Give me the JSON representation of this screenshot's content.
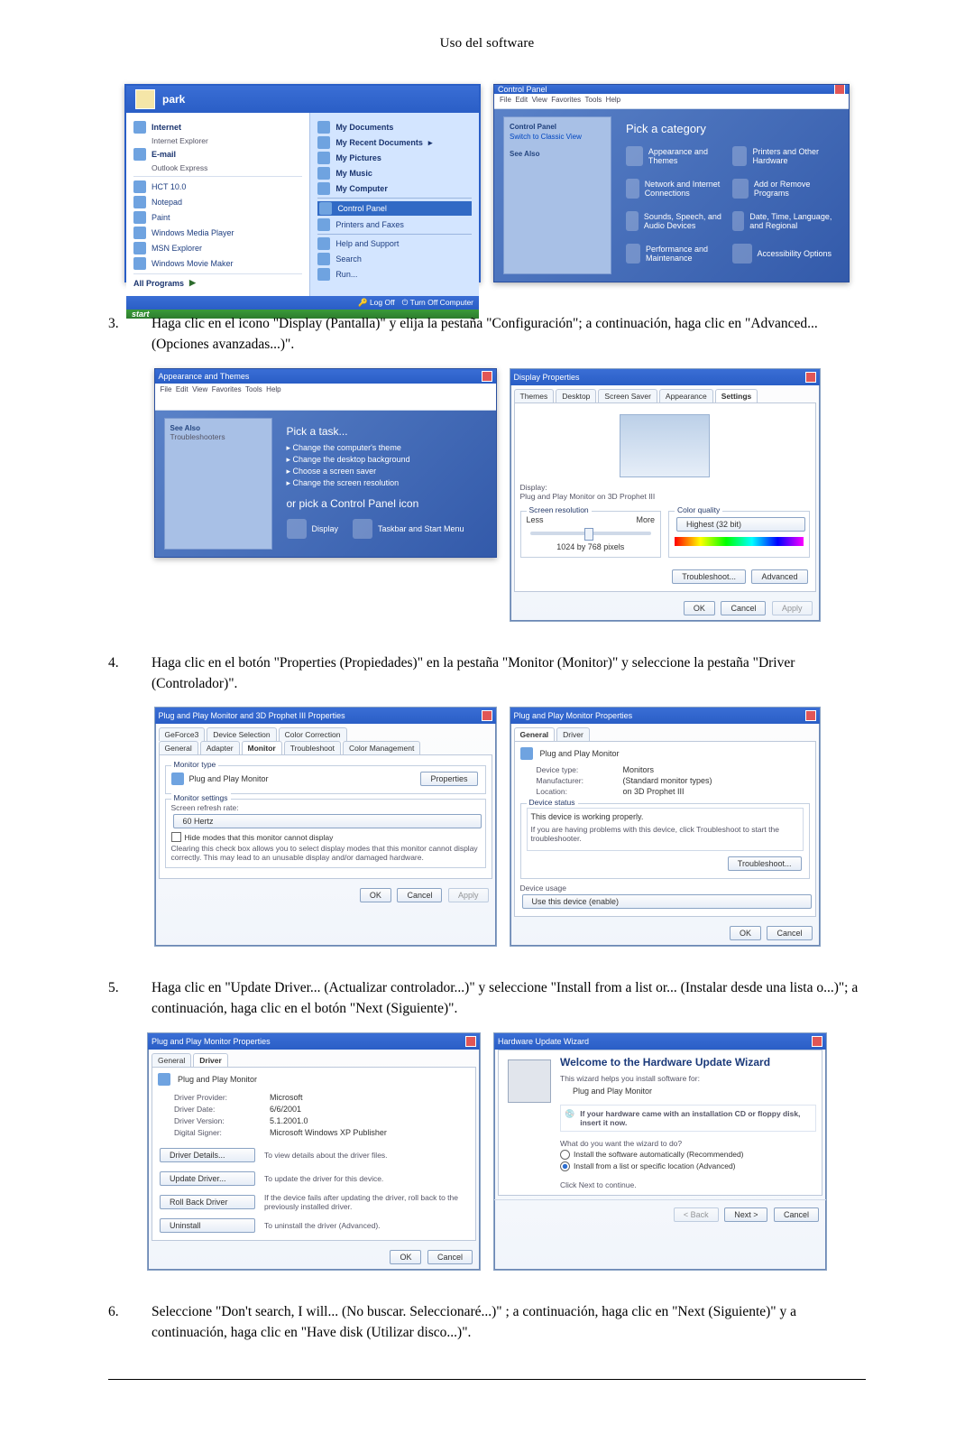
{
  "page_header": "Uso del software",
  "steps": {
    "s3": {
      "num": "3.",
      "text": "Haga clic en el icono \"Display (Pantalla)\" y elija la pestaña \"Configuración\"; a continuación, haga clic en \"Advanced... (Opciones avanzadas...)\"."
    },
    "s4": {
      "num": "4.",
      "text": "Haga clic en el botón \"Properties (Propiedades)\" en la pestaña \"Monitor (Monitor)\" y seleccione la pestaña \"Driver (Controlador)\"."
    },
    "s5": {
      "num": "5.",
      "text": "Haga clic en \"Update Driver... (Actualizar controlador...)\" y seleccione \"Install from a list or... (Instalar desde una lista o...)\"; a continuación, haga clic en el botón \"Next (Siguiente)\"."
    },
    "s6": {
      "num": "6.",
      "text": "Seleccione \"Don't search, I will... (No buscar. Seleccionaré...)\" ; a continuación, haga clic en \"Next (Siguiente)\" y a continuación, haga clic en \"Have disk (Utilizar disco...)\"."
    }
  },
  "start": {
    "user": "park",
    "left": [
      "Internet",
      "E-mail",
      "HCT 10.0",
      "Notepad",
      "Paint",
      "Windows Media Player",
      "MSN Explorer",
      "Windows Movie Maker"
    ],
    "left_sub": [
      "Internet Explorer",
      "Outlook Express"
    ],
    "all_programs": "All Programs",
    "right": [
      "My Documents",
      "My Recent Documents",
      "My Pictures",
      "My Music",
      "My Computer",
      "Control Panel",
      "Printers and Faxes",
      "Help and Support",
      "Search",
      "Run..."
    ],
    "footer": [
      "Log Off",
      "Turn Off Computer"
    ],
    "taskbar": "start"
  },
  "controlpanel": {
    "title": "Control Panel",
    "heading": "Pick a category",
    "cats": [
      "Appearance and Themes",
      "Network and Internet Connections",
      "Add or Remove Programs",
      "Sounds, Speech, and Audio Devices",
      "Performance and Maintenance",
      "Printers and Other Hardware",
      "Date, Time, Language, and Regional",
      "Accessibility Options"
    ],
    "side_head": "Control Panel",
    "side_switch": "Switch to Classic View",
    "seealso": "See Also"
  },
  "appearance": {
    "title": "Appearance and Themes",
    "pick": "Pick a task...",
    "tasks": [
      "Change the computer's theme",
      "Change the desktop background",
      "Choose a screen saver",
      "Change the screen resolution"
    ],
    "orpick": "or pick a Control Panel icon",
    "icons": [
      "Display",
      "Taskbar and Start Menu"
    ]
  },
  "display_props": {
    "title": "Display Properties",
    "tabs": [
      "Themes",
      "Desktop",
      "Screen Saver",
      "Appearance",
      "Settings"
    ],
    "display_label": "Display:",
    "display_value": "Plug and Play Monitor on 3D Prophet III",
    "res_legend": "Screen resolution",
    "less": "Less",
    "more": "More",
    "res": "1024 by 768 pixels",
    "color_legend": "Color quality",
    "color": "Highest (32 bit)",
    "btns": [
      "Troubleshoot...",
      "Advanced",
      "OK",
      "Cancel",
      "Apply"
    ]
  },
  "pnp_3d": {
    "title": "Plug and Play Monitor and 3D Prophet III Properties",
    "tabs_row1": [
      "GeForce3",
      "Device Selection",
      "Color Correction"
    ],
    "tabs_row2": [
      "General",
      "Adapter",
      "Monitor",
      "Troubleshoot",
      "Color Management"
    ],
    "mt_legend": "Monitor type",
    "mt_value": "Plug and Play Monitor",
    "properties_btn": "Properties",
    "ms_legend": "Monitor settings",
    "refresh_label": "Screen refresh rate:",
    "refresh_value": "60 Hertz",
    "hide_chk": "Hide modes that this monitor cannot display",
    "hide_note": "Clearing this check box allows you to select display modes that this monitor cannot display correctly. This may lead to an unusable display and/or damaged hardware.",
    "btns": [
      "OK",
      "Cancel",
      "Apply"
    ]
  },
  "pnp_props_general": {
    "title": "Plug and Play Monitor Properties",
    "tabs": [
      "General",
      "Driver"
    ],
    "name": "Plug and Play Monitor",
    "dtype_l": "Device type:",
    "dtype_v": "Monitors",
    "manu_l": "Manufacturer:",
    "manu_v": "(Standard monitor types)",
    "loc_l": "Location:",
    "loc_v": "on 3D Prophet III",
    "ds_legend": "Device status",
    "ds_text": "This device is working properly.",
    "ds_note": "If you are having problems with this device, click Troubleshoot to start the troubleshooter.",
    "ts_btn": "Troubleshoot...",
    "du_legend": "Device usage",
    "du_value": "Use this device (enable)",
    "btns": [
      "OK",
      "Cancel"
    ]
  },
  "pnp_props_driver": {
    "title": "Plug and Play Monitor Properties",
    "tabs": [
      "General",
      "Driver"
    ],
    "name": "Plug and Play Monitor",
    "prov_l": "Driver Provider:",
    "prov_v": "Microsoft",
    "date_l": "Driver Date:",
    "date_v": "6/6/2001",
    "ver_l": "Driver Version:",
    "ver_v": "5.1.2001.0",
    "sign_l": "Digital Signer:",
    "sign_v": "Microsoft Windows XP Publisher",
    "b_details": "Driver Details...",
    "b_details_d": "To view details about the driver files.",
    "b_update": "Update Driver...",
    "b_update_d": "To update the driver for this device.",
    "b_roll": "Roll Back Driver",
    "b_roll_d": "If the device fails after updating the driver, roll back to the previously installed driver.",
    "b_unin": "Uninstall",
    "b_unin_d": "To uninstall the driver (Advanced).",
    "btns": [
      "OK",
      "Cancel"
    ]
  },
  "wizard": {
    "title": "Hardware Update Wizard",
    "heading": "Welcome to the Hardware Update Wizard",
    "line1": "This wizard helps you install software for:",
    "device": "Plug and Play Monitor",
    "cd_note": "If your hardware came with an installation CD or floppy disk, insert it now.",
    "q": "What do you want the wizard to do?",
    "opt1": "Install the software automatically (Recommended)",
    "opt2": "Install from a list or specific location (Advanced)",
    "cont": "Click Next to continue.",
    "btns": [
      "< Back",
      "Next >",
      "Cancel"
    ]
  }
}
